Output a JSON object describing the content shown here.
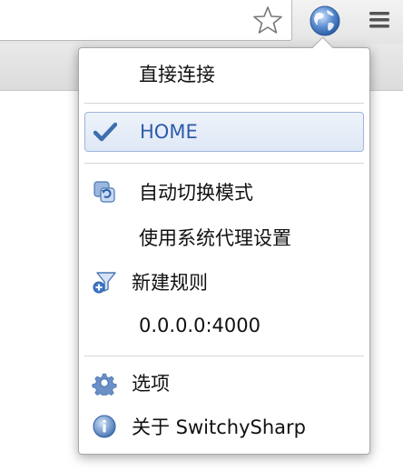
{
  "toolbar": {
    "bookmark_icon": "star-outline-icon",
    "extension_icon": "globe-icon",
    "menu_icon": "hamburger-icon"
  },
  "popup": {
    "items": [
      {
        "label": "直接连接",
        "icon": null
      },
      {
        "label": "HOME",
        "icon": "checkmark-icon",
        "selected": true
      },
      {
        "label": "自动切换模式",
        "icon": "auto-switch-icon"
      },
      {
        "label": "使用系统代理设置",
        "icon": null
      },
      {
        "label": "新建规则",
        "icon": "new-rule-filter-icon"
      },
      {
        "label": "0.0.0.0:4000",
        "icon": null
      },
      {
        "label": "选项",
        "icon": "gear-icon"
      },
      {
        "label": "关于 SwitchySharp",
        "icon": "info-icon"
      }
    ]
  },
  "colors": {
    "selected_text": "#2d5ca8",
    "selected_border": "#9eb5d8",
    "icon_blue": "#4a77b4"
  }
}
